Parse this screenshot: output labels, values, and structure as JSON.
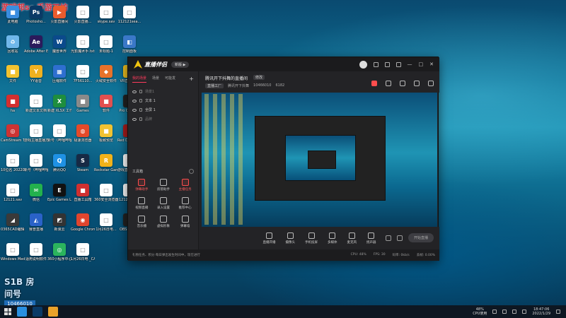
{
  "watermark": "游戏邦sc 手游工坊",
  "desktop_icons": [
    {
      "label": "此电脑",
      "color": "#3a8de0",
      "glyph": "■"
    },
    {
      "label": "Photosho...",
      "color": "#0a3a66",
      "glyph": "Ps"
    },
    {
      "label": "火影直播间",
      "color": "#e95b2e",
      "glyph": "▶"
    },
    {
      "label": "火影直播...",
      "color": "#ffffff",
      "glyph": "□"
    },
    {
      "label": "skype.sav",
      "color": "#ffffff",
      "glyph": "□"
    },
    {
      "label": "112121sea...",
      "color": "#ffffff",
      "glyph": "□"
    },
    {
      "label": "回收站",
      "color": "#6fb7ea",
      "glyph": "♻"
    },
    {
      "label": "Adobe After Effects 2020",
      "color": "#2b1a5c",
      "glyph": "Ae"
    },
    {
      "label": "魔兽世界",
      "color": "#0b4a8c",
      "glyph": "W"
    },
    {
      "label": "光影魔术手.txt",
      "color": "#ffffff",
      "glyph": "□"
    },
    {
      "label": "未标题-1",
      "color": "#ffffff",
      "glyph": "□"
    },
    {
      "label": "控制面板",
      "color": "#3a78c8",
      "glyph": "◧"
    },
    {
      "label": "文件",
      "color": "#f2c230",
      "glyph": "■"
    },
    {
      "label": "YY语音",
      "color": "#f0b120",
      "glyph": "Y"
    },
    {
      "label": "压缩软件",
      "color": "#2e6fd0",
      "glyph": "▦"
    },
    {
      "label": "7F56110...",
      "color": "#ffffff",
      "glyph": "□"
    },
    {
      "label": "火绒安全软件",
      "color": "#e8722a",
      "glyph": "◆"
    },
    {
      "label": "VR直播课程",
      "color": "#f0c020",
      "glyph": "■"
    },
    {
      "label": "ha",
      "color": "#d32f2f",
      "glyph": "■"
    },
    {
      "label": "新建文本文档",
      "color": "#ffffff",
      "glyph": "□"
    },
    {
      "label": "新建 XLSX 工作表",
      "color": "#1e8e3e",
      "glyph": "X"
    },
    {
      "label": "Games",
      "color": "#8a8a8a",
      "glyph": "■"
    },
    {
      "label": "软件",
      "color": "#e25050",
      "glyph": "■"
    },
    {
      "label": "Pro Camera",
      "color": "#222222",
      "glyph": "◎"
    },
    {
      "label": "CamStream The Cam...",
      "color": "#cc3333",
      "glyph": "◎"
    },
    {
      "label": "游戏主播直播方案.txt",
      "color": "#ffffff",
      "glyph": "□"
    },
    {
      "label": "新号（哔哩哔哩）.txt",
      "color": "#ffffff",
      "glyph": "□"
    },
    {
      "label": "极速浏览器",
      "color": "#e54a2a",
      "glyph": "◍"
    },
    {
      "label": "极致预览",
      "color": "#f1c232",
      "glyph": "■"
    },
    {
      "label": "Red Dead Redempti...",
      "color": "#a81c1c",
      "glyph": "R"
    },
    {
      "label": "10位名 20220121...",
      "color": "#ffffff",
      "glyph": "□"
    },
    {
      "label": "新号（哔哩哔哩）_CAL...",
      "color": "#ffffff",
      "glyph": "□"
    },
    {
      "label": "腾讯QQ",
      "color": "#1f91e4",
      "glyph": "Q"
    },
    {
      "label": "Steam",
      "color": "#172a45",
      "glyph": "S"
    },
    {
      "label": "Rockstar Games...",
      "color": "#f1b21a",
      "glyph": "R"
    },
    {
      "label": "游戏直播方案1111.sav",
      "color": "#ffffff",
      "glyph": "□"
    },
    {
      "label": "12121.sav",
      "color": "#ffffff",
      "glyph": "□"
    },
    {
      "label": "微信",
      "color": "#23b14d",
      "glyph": "✉"
    },
    {
      "label": "Epic Games Launcher",
      "color": "#111111",
      "glyph": "E"
    },
    {
      "label": "直播工具箱",
      "color": "#d03030",
      "glyph": "■"
    },
    {
      "label": "360安全浏览器",
      "color": "#ffffff",
      "glyph": "□"
    },
    {
      "label": "12121_CA...",
      "color": "#ffffff",
      "glyph": "□"
    },
    {
      "label": "0365CAD编辑器",
      "color": "#3a3a3a",
      "glyph": "◢"
    },
    {
      "label": "赛普直播",
      "color": "#2a62c8",
      "glyph": "◭"
    },
    {
      "label": "新浪云",
      "color": "#333333",
      "glyph": "◩"
    },
    {
      "label": "Google Chrome",
      "color": "#e0452e",
      "glyph": "◉"
    },
    {
      "label": "1月26日电...",
      "color": "#ffffff",
      "glyph": "□"
    },
    {
      "label": "OBS Studio",
      "color": "#222222",
      "glyph": "◎"
    },
    {
      "label": "Windows Media...",
      "color": "#ffffff",
      "glyph": "□"
    },
    {
      "label": "适用说明软件",
      "color": "#ffffff",
      "glyph": "□"
    },
    {
      "label": "360小程序中心",
      "color": "#2bb45d",
      "glyph": "◎"
    },
    {
      "label": "1月26日电 _CALCUL...",
      "color": "#ffffff",
      "glyph": "□"
    }
  ],
  "room_badge": {
    "brand": "S1B 房间号",
    "number": "10466010"
  },
  "app": {
    "logo": "直播伴侣",
    "version": "新版 ▶",
    "sidebar": {
      "tabs": [
        "我的场景",
        "场景",
        "可能发"
      ],
      "scenes": [
        "场景1",
        "文本 1",
        "全屏 1",
        "品牌"
      ],
      "tools_title": "工具箱",
      "tools": [
        {
          "label": "弹幕助手",
          "red": true
        },
        {
          "label": "房管助手",
          "red": false
        },
        {
          "label": "主播任务",
          "red": true
        },
        {
          "label": "视频直播",
          "red": false
        },
        {
          "label": "录入设置",
          "red": false
        },
        {
          "label": "推荐中心",
          "red": false
        },
        {
          "label": "音乐播",
          "red": false
        },
        {
          "label": "虚拟形象",
          "red": false
        },
        {
          "label": "弹幕墙",
          "red": false
        }
      ]
    },
    "header": {
      "title": "腾讯开下抖舞的直播间",
      "edit": "修改",
      "category": "直播工厂",
      "subtitle": "腾讯开下抖舞",
      "room_id": "10466010",
      "viewers": "6182"
    },
    "bottom": {
      "controls": [
        "直播开播",
        "摄像头",
        "手机投屏",
        "多媒体",
        "麦克风",
        "扬声器"
      ],
      "start_button": "开始直播"
    },
    "status": {
      "left": "礼物任务、积分 每日弹出发生时间中，现在进行",
      "cpu": "CPU: 48%",
      "fps": "FPS: 30",
      "bitrate": "码率: 0kb/s",
      "lost": "丢帧: 0.00%"
    }
  },
  "taskbar": {
    "cpu_percent": "48%",
    "cpu_label": "CPU使用",
    "time": "18:47:06",
    "date": "2022/1/29"
  }
}
